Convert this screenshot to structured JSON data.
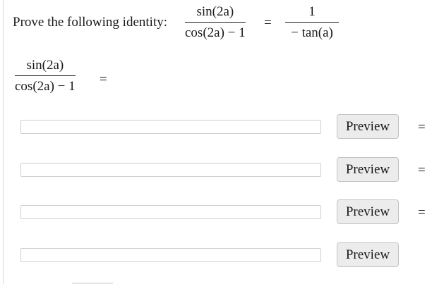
{
  "prompt": "Prove the following identity:",
  "identity": {
    "lhs_num": "sin(2a)",
    "lhs_den": "cos(2a) − 1",
    "equals": "=",
    "rhs_num": "1",
    "rhs_den": "− tan(a)"
  },
  "work": {
    "num": "sin(2a)",
    "den": "cos(2a) − 1",
    "equals": "="
  },
  "rows": [
    {
      "input_value": "",
      "button_label": "Preview",
      "equals": "="
    },
    {
      "input_value": "",
      "button_label": "Preview",
      "equals": "="
    },
    {
      "input_value": "",
      "button_label": "Preview",
      "equals": "="
    },
    {
      "input_value": "",
      "button_label": "Preview",
      "equals": ""
    }
  ]
}
